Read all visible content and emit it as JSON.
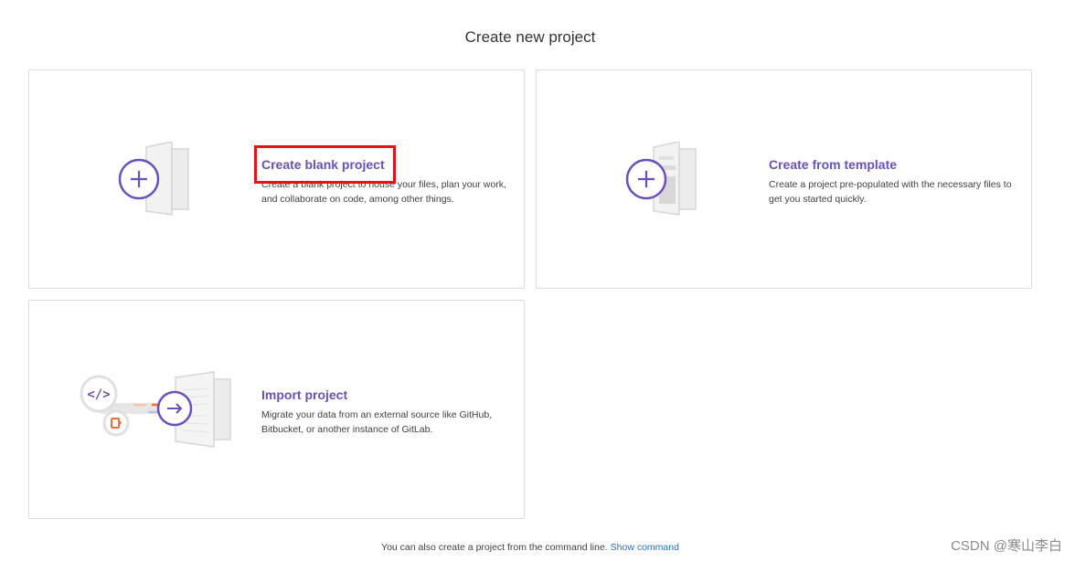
{
  "page": {
    "title": "Create new project"
  },
  "cards": {
    "blank": {
      "title": "Create blank project",
      "description": "Create a blank project to house your files, plan your work, and collaborate on code, among other things."
    },
    "template": {
      "title": "Create from template",
      "description": "Create a project pre-populated with the necessary files to get you started quickly."
    },
    "import": {
      "title": "Import project",
      "description": "Migrate your data from an external source like GitHub, Bitbucket, or another instance of GitLab."
    }
  },
  "footer": {
    "text": "You can also create a project from the command line.",
    "link": "Show command"
  },
  "watermark": "CSDN @寒山李白",
  "colors": {
    "accent": "#6b4fbb",
    "highlight": "#e8101b",
    "link": "#1f6fc5"
  }
}
